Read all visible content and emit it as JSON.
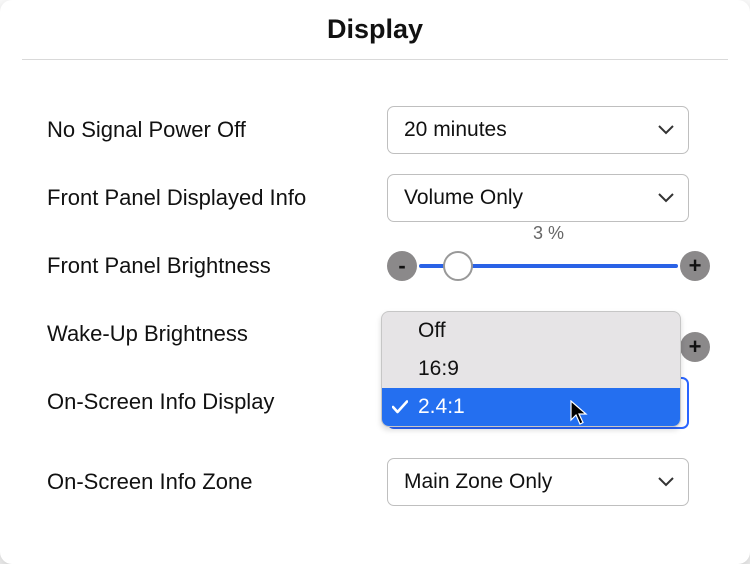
{
  "title": "Display",
  "rows": {
    "no_signal": {
      "label": "No Signal Power Off",
      "value": "20 minutes"
    },
    "front_info": {
      "label": "Front Panel Displayed Info",
      "value": "Volume Only"
    },
    "brightness": {
      "label": "Front Panel Brightness",
      "value_text": "3 %",
      "value_pct": 15
    },
    "wake": {
      "label": "Wake-Up Brightness"
    },
    "osd": {
      "label": "On-Screen Info Display"
    },
    "zone": {
      "label": "On-Screen Info Zone",
      "value": "Main Zone Only"
    }
  },
  "dropdown": {
    "items": [
      "Off",
      "16:9",
      "2.4:1"
    ],
    "selected": "2.4:1"
  },
  "glyphs": {
    "minus": "-",
    "plus": "+"
  }
}
